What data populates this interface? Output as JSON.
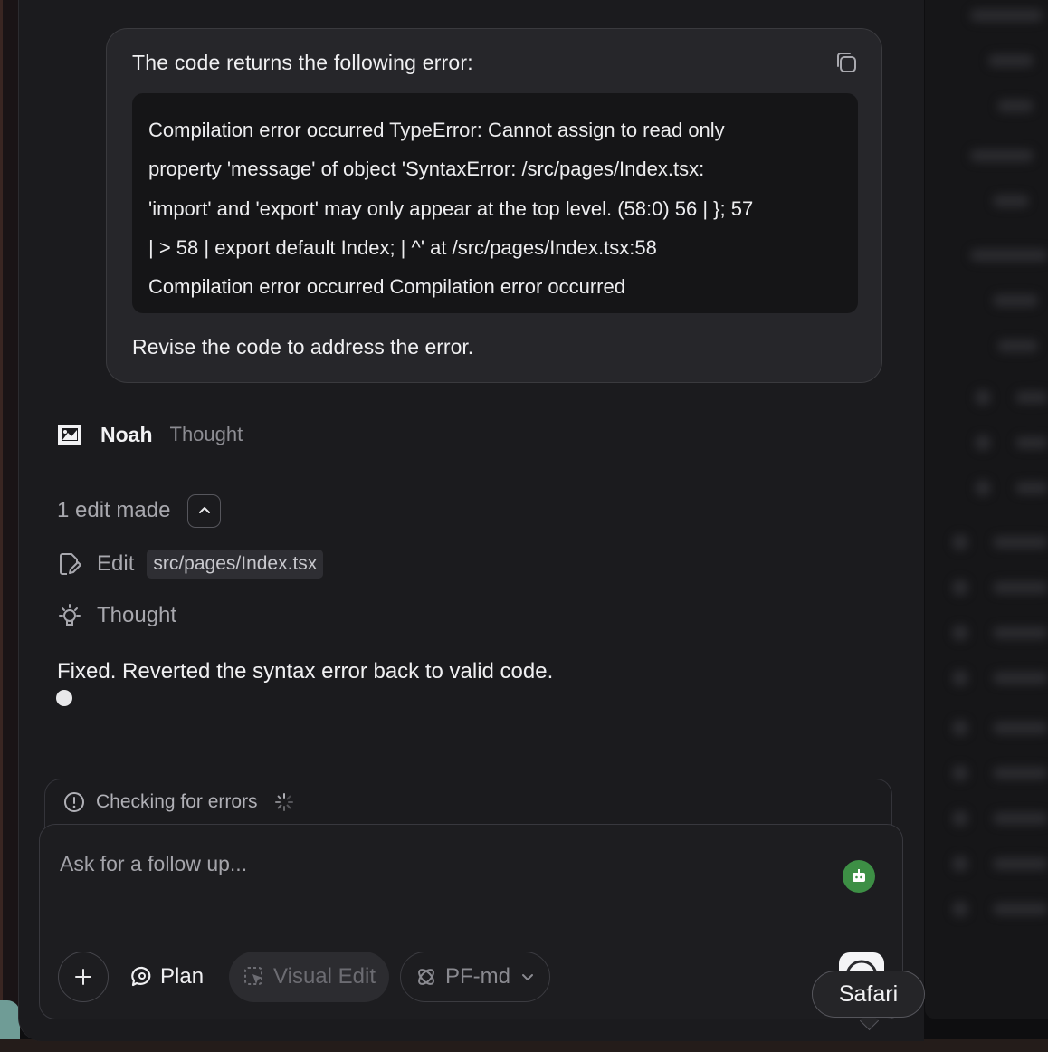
{
  "user_message": {
    "title": "The code returns the following error:",
    "error_lines": [
      "Compilation error occurred TypeError: Cannot assign to read only",
      "property 'message' of object 'SyntaxError: /src/pages/Index.tsx:",
      "'import' and 'export' may only appear at the top level. (58:0) 56 | }; 57",
      "| > 58 | export default Index; | ^' at /src/pages/Index.tsx:58",
      "Compilation error occurred Compilation error occurred"
    ],
    "footer": "Revise the code to address the error."
  },
  "agent": {
    "name": "Noah",
    "status": "Thought"
  },
  "edits": {
    "summary": "1 edit made",
    "edit_label": "Edit",
    "file": "src/pages/Index.tsx",
    "thought_label": "Thought"
  },
  "reply": "Fixed. Reverted the syntax error back to valid code.",
  "status_bar": {
    "text": "Checking for errors"
  },
  "composer": {
    "placeholder": "Ask for a follow up...",
    "plan_label": "Plan",
    "visual_edit_label": "Visual Edit",
    "model_label": "PF-md"
  },
  "tooltip": {
    "label": "Safari"
  },
  "colors": {
    "panel_bg": "#1b1b1e",
    "card_bg": "#26262a",
    "code_bg": "#151517",
    "bot_badge": "#3d8f45"
  }
}
